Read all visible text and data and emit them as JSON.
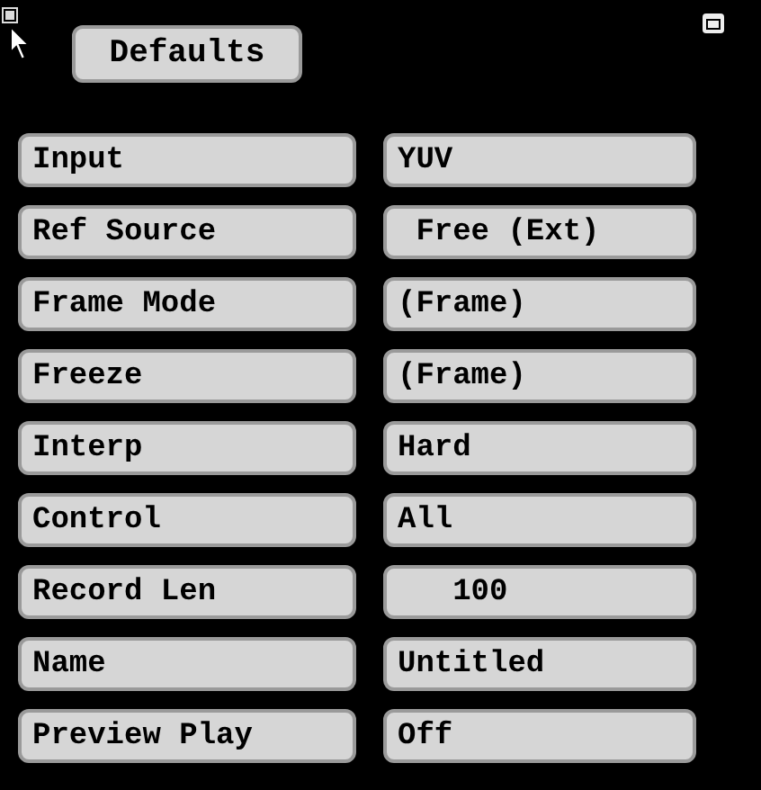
{
  "title_button": "Defaults",
  "rows": [
    {
      "label": "Input",
      "value": "YUV"
    },
    {
      "label": "Ref Source",
      "value": " Free (Ext)"
    },
    {
      "label": "Frame Mode",
      "value": "(Frame)"
    },
    {
      "label": "Freeze",
      "value": "(Frame)"
    },
    {
      "label": "Interp",
      "value": "Hard"
    },
    {
      "label": "Control",
      "value": "All"
    },
    {
      "label": "Record Len",
      "value": "   100"
    },
    {
      "label": "Name",
      "value": "Untitled"
    },
    {
      "label": "Preview Play",
      "value": "Off"
    }
  ]
}
